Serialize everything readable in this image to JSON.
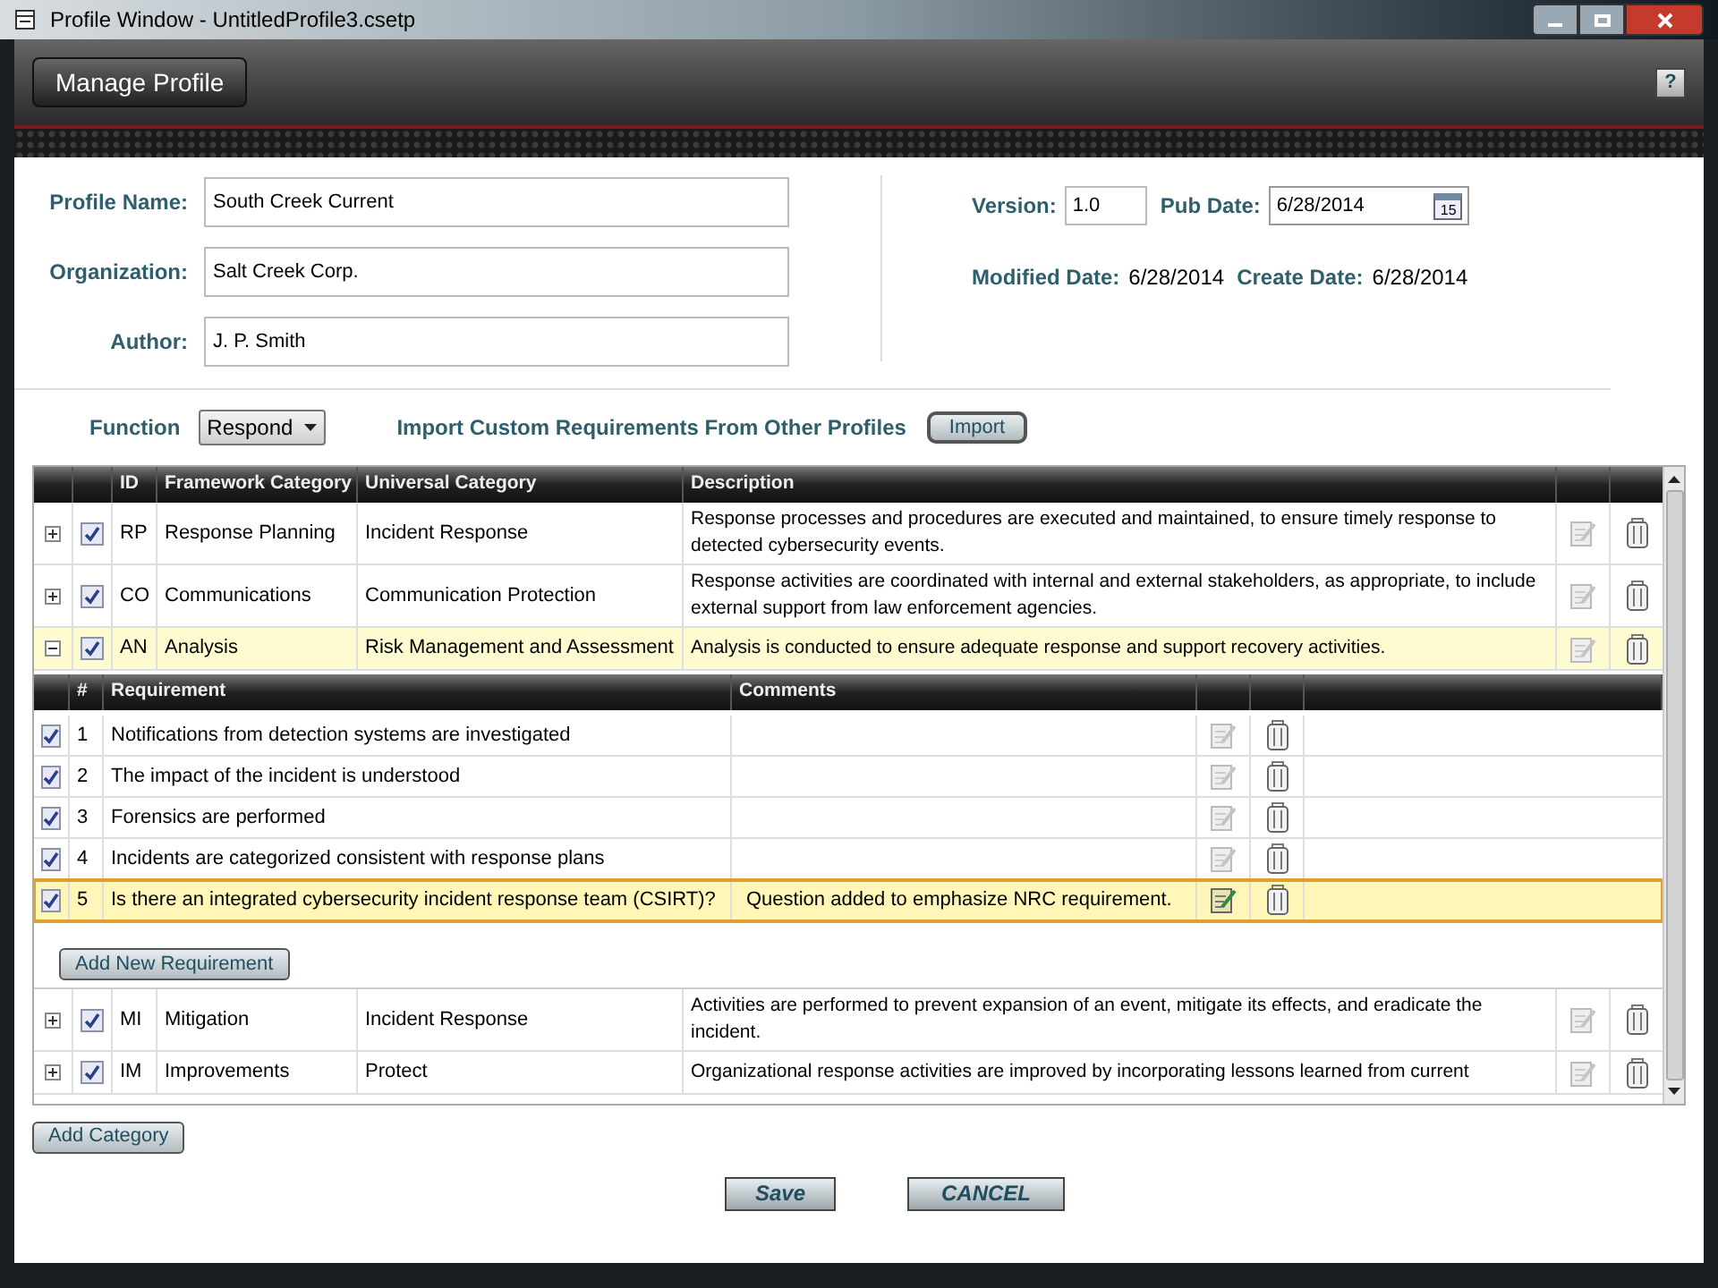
{
  "window": {
    "title": "Profile Window - UntitledProfile3.csetp"
  },
  "header": {
    "title_button": "Manage Profile",
    "help": "?"
  },
  "form": {
    "fields": [
      {
        "label": "Profile Name:",
        "value": "South Creek Current"
      },
      {
        "label": "Organization:",
        "value": "Salt Creek Corp."
      },
      {
        "label": "Author:",
        "value": "J. P. Smith"
      }
    ],
    "version": {
      "label": "Version:",
      "value": "1.0"
    },
    "pub_date": {
      "label": "Pub Date:",
      "value": "6/28/2014",
      "calendar_day": "15"
    },
    "modified_date": {
      "label": "Modified Date:",
      "value": "6/28/2014"
    },
    "create_date": {
      "label": "Create Date:",
      "value": "6/28/2014"
    }
  },
  "function": {
    "label": "Function",
    "value": "Respond",
    "import_label": "Import Custom Requirements From Other Profiles",
    "import_button": "Import"
  },
  "categories": {
    "columns": [
      "ID",
      "Framework Category",
      "Universal Category",
      "Description"
    ],
    "rows": [
      {
        "expanded": false,
        "checked": true,
        "selected": false,
        "id": "RP",
        "framework": "Response Planning",
        "universal": "Incident Response",
        "description": "Response processes and procedures are executed and maintained, to ensure timely response to detected cybersecurity events."
      },
      {
        "expanded": false,
        "checked": true,
        "selected": false,
        "id": "CO",
        "framework": "Communications",
        "universal": "Communication Protection",
        "description": "Response activities are coordinated with internal and external stakeholders, as appropriate, to include external support from law enforcement agencies."
      },
      {
        "expanded": true,
        "checked": true,
        "selected": true,
        "id": "AN",
        "framework": "Analysis",
        "universal": "Risk Management and Assessment",
        "description": "Analysis is conducted to ensure adequate response and support recovery activities.",
        "requirements": {
          "columns": [
            "#",
            "Requirement",
            "Comments"
          ],
          "rows": [
            {
              "checked": true,
              "selected": false,
              "number": "1",
              "text": "Notifications from detection systems are investigated"
            },
            {
              "checked": true,
              "selected": false,
              "number": "2",
              "text": "The impact of the incident is understood"
            },
            {
              "checked": true,
              "selected": false,
              "number": "3",
              "text": "Forensics are performed"
            },
            {
              "checked": true,
              "selected": false,
              "number": "4",
              "text": "Incidents are categorized consistent with response plans"
            },
            {
              "checked": true,
              "selected": true,
              "number": "5",
              "text": "Is there an integrated cybersecurity incident response team (CSIRT)?",
              "comment": "Question added to emphasize NRC requirement."
            }
          ],
          "add_button": "Add New Requirement"
        }
      },
      {
        "expanded": false,
        "checked": true,
        "selected": false,
        "id": "MI",
        "framework": "Mitigation",
        "universal": "Incident Response",
        "description": "Activities are performed to prevent expansion of an event, mitigate its effects, and eradicate the incident."
      },
      {
        "expanded": false,
        "checked": true,
        "selected": false,
        "id": "IM",
        "framework": "Improvements",
        "universal": "Protect",
        "description": "Organizational response activities are improved by incorporating lessons learned from current"
      }
    ],
    "add_button": "Add Category"
  },
  "footer": {
    "save": "Save",
    "cancel": "CANCEL"
  }
}
